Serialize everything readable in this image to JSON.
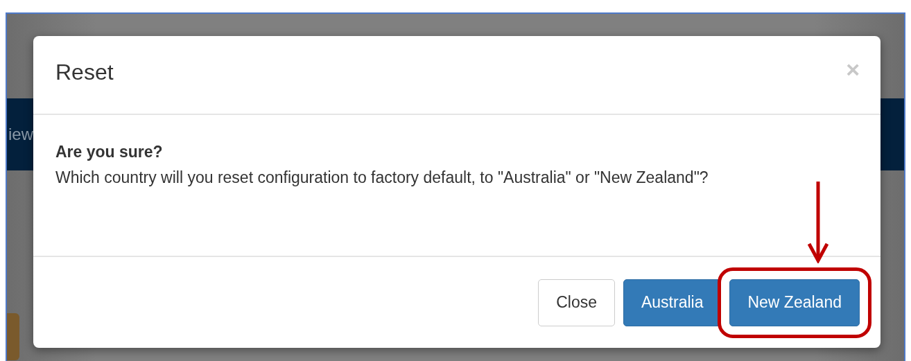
{
  "background": {
    "nav_text": "iew"
  },
  "dialog": {
    "title": "Reset",
    "close_icon": "×",
    "heading": "Are you sure?",
    "message": "Which country will you reset configuration to factory default, to \"Australia\" or \"New Zealand\"?",
    "buttons": [
      {
        "label": "Close",
        "kind": "default",
        "highlighted": false
      },
      {
        "label": "Australia",
        "kind": "primary",
        "highlighted": false
      },
      {
        "label": "New Zealand",
        "kind": "primary",
        "highlighted": true
      }
    ]
  }
}
